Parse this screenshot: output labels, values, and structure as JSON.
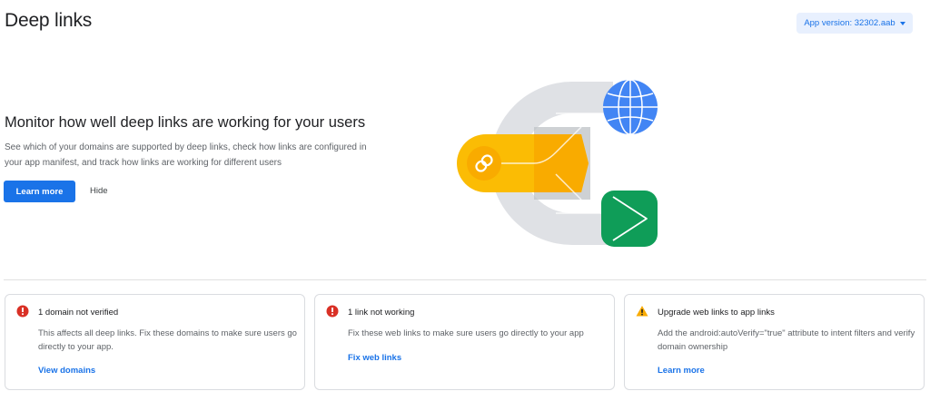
{
  "header": {
    "title": "Deep links",
    "version_label": "App version: 32302.aab"
  },
  "hero": {
    "heading": "Monitor how well deep links are working for your users",
    "description": "See which of your domains are supported by deep links, check how links are configured in your app manifest, and track how links are working for different users",
    "primary_button": "Learn more",
    "secondary_button": "Hide"
  },
  "cards": [
    {
      "icon": "error-icon",
      "title": "1 domain not verified",
      "body": "This affects all deep links. Fix these domains to make sure users go directly to your app.",
      "link": "View domains"
    },
    {
      "icon": "error-icon",
      "title": "1 link not working",
      "body": "Fix these web links to make sure users go directly to your app",
      "link": "Fix web links"
    },
    {
      "icon": "warning-icon",
      "title": "Upgrade web links to app links",
      "body": "Add the android:autoVerify=\"true\" attribute to intent filters and verify domain ownership",
      "link": "Learn more"
    }
  ],
  "colors": {
    "accent": "#1a73e8",
    "error": "#d93025",
    "warning": "#f9ab00",
    "globe": "#4285f4",
    "arrow": "#0f9d58",
    "link_tile": "#fbbc04"
  }
}
